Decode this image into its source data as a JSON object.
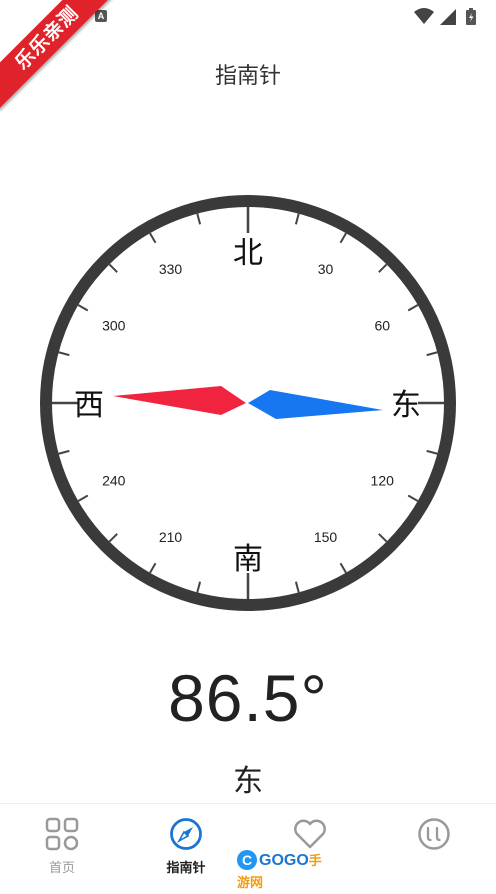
{
  "status_bar": {
    "notification_badge": "A"
  },
  "ribbon": {
    "text": "乐乐亲测"
  },
  "header": {
    "title": "指南针"
  },
  "compass": {
    "cardinals": {
      "north": "北",
      "east": "东",
      "south": "南",
      "west": "西"
    },
    "degree_labels": [
      "30",
      "60",
      "120",
      "150",
      "210",
      "240",
      "300",
      "330"
    ],
    "needle_north_color": "#f0243f",
    "needle_south_color": "#1677f0",
    "ring_color": "#3a3a3a"
  },
  "reading": {
    "heading": "86.5°",
    "direction": "东"
  },
  "tabs": [
    {
      "label": "首页",
      "icon": "grid-icon",
      "active": false
    },
    {
      "label": "指南针",
      "icon": "compass-icon",
      "active": true
    },
    {
      "label": "",
      "icon": "heart-icon",
      "active": false
    },
    {
      "label": "",
      "icon": "smile-icon",
      "active": false
    }
  ],
  "watermark": {
    "logo": "C",
    "brand": "GOGO",
    "cn": "手游网"
  },
  "colors": {
    "accent": "#1976d2",
    "ribbon": "#e0232b"
  }
}
